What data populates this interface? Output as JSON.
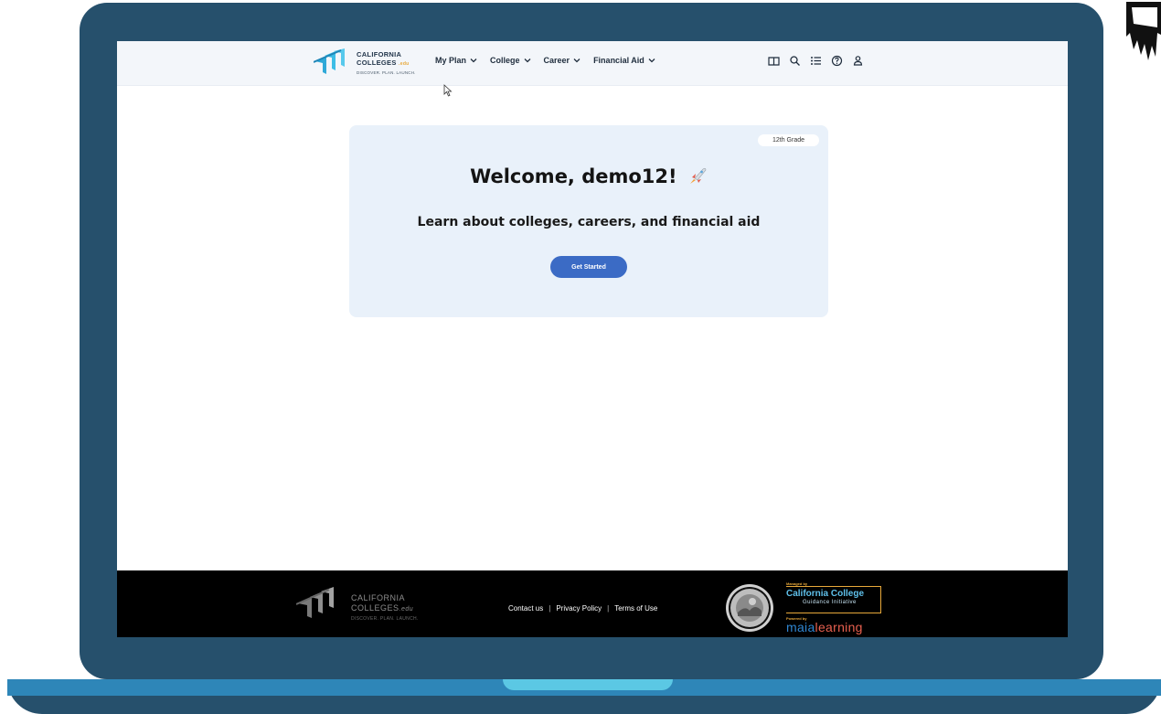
{
  "header": {
    "logo": {
      "line1": "CALIFORNIA",
      "line2": "COLLEGES",
      "edu": ".edu",
      "tagline": "DISCOVER. PLAN. LAUNCH."
    },
    "nav": [
      {
        "label": "My Plan"
      },
      {
        "label": "College"
      },
      {
        "label": "Career"
      },
      {
        "label": "Financial Aid"
      }
    ],
    "icons": [
      "book-icon",
      "search-icon",
      "list-icon",
      "help-icon",
      "user-icon"
    ]
  },
  "welcome": {
    "grade": "12th Grade",
    "title": "Welcome, demo12!",
    "subtitle": "Learn about colleges, careers, and financial aid",
    "button": "Get Started"
  },
  "footer": {
    "logo": {
      "line1": "CALIFORNIA",
      "line2": "COLLEGES",
      "edu": ".edu",
      "tagline": "DISCOVER. PLAN. LAUNCH."
    },
    "links": [
      "Contact us",
      "Privacy Policy",
      "Terms of Use"
    ],
    "managed_by": "Managed by",
    "ccgi_name": "California College",
    "ccgi_sub": "Guidance Initiative",
    "powered_by": "Powered by",
    "maia_a": "maia",
    "maia_b": "learning"
  },
  "colors": {
    "frame": "#26506c",
    "accent_blue": "#3b6bc5",
    "card_bg": "#e9f1fa",
    "footer_bg": "#000000"
  }
}
